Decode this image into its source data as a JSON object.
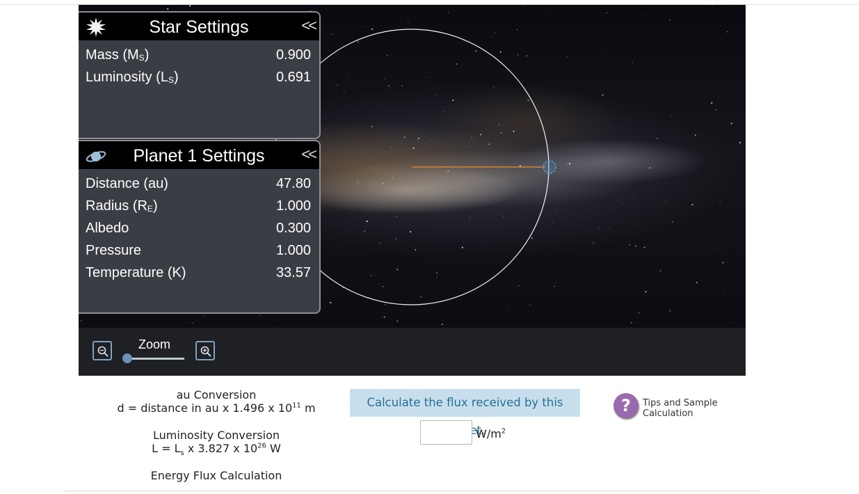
{
  "star_panel": {
    "title": "Star Settings",
    "collapse": "<<",
    "icon": "star-icon",
    "rows": [
      {
        "label": "Mass (M",
        "sub": "S",
        "suffix": ")",
        "value": "0.900"
      },
      {
        "label": "Luminosity (L",
        "sub": "S",
        "suffix": ")",
        "value": "0.691"
      }
    ]
  },
  "planet_panel": {
    "title": "Planet 1 Settings",
    "collapse": "<<",
    "icon": "planet-icon",
    "rows": [
      {
        "label": "Distance (au)",
        "value": "47.80"
      },
      {
        "label": "Radius (R",
        "sub": "E",
        "suffix": ")",
        "value": "1.000"
      },
      {
        "label": "Albedo",
        "value": "0.300"
      },
      {
        "label": "Pressure",
        "value": "1.000"
      },
      {
        "label": "Temperature (K)",
        "value": "33.57"
      }
    ]
  },
  "zoom": {
    "label": "Zoom",
    "level": 0
  },
  "au_conversion": {
    "title": "au Conversion",
    "formula_pre": "d = distance in au x 1.496 x 10",
    "exp": "11",
    "formula_post": " m"
  },
  "lum_conversion": {
    "title": "Luminosity Conversion",
    "formula_pre": "L = L",
    "sub": "s",
    "formula_mid": " x 3.827 x 10",
    "exp": "26",
    "formula_post": " W"
  },
  "flux_title": "Energy Flux Calculation",
  "prompt": "Calculate the flux received by this planet.",
  "answer": {
    "value": "",
    "units": "W/m",
    "units_exp": "2"
  },
  "help": {
    "icon_label": "?",
    "text": "Tips and Sample Calculation"
  },
  "colors": {
    "prompt_bg": "#c7dfed",
    "prompt_text": "#2a6f93",
    "help": "#9a6aae",
    "orbit_line": "#d9822b"
  }
}
